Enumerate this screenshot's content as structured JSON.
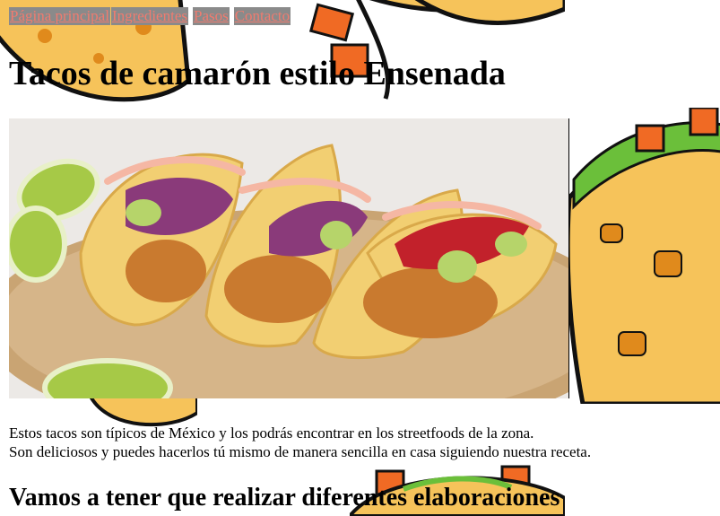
{
  "nav": {
    "items": [
      "Página principal",
      "Ingredientes",
      "Pasos",
      "Contacto"
    ]
  },
  "page": {
    "title": "Tacos de camarón estilo Ensenada",
    "intro_line1": "Estos tacos son típicos de México y los podrás encontrar en los streetfoods de la zona.",
    "intro_line2": "Son deliciosos y puedes hacerlos tú mismo de manera sencilla en casa siguiendo nuestra receta.",
    "section_heading": "Vamos a tener que realizar diferentes elaboraciones"
  },
  "colors": {
    "nav_bg": "#8a8a8a",
    "nav_text": "#f07b6f",
    "tortilla": "#f6c35a",
    "filling": "#f06a24",
    "lettuce": "#6bbf3a"
  }
}
